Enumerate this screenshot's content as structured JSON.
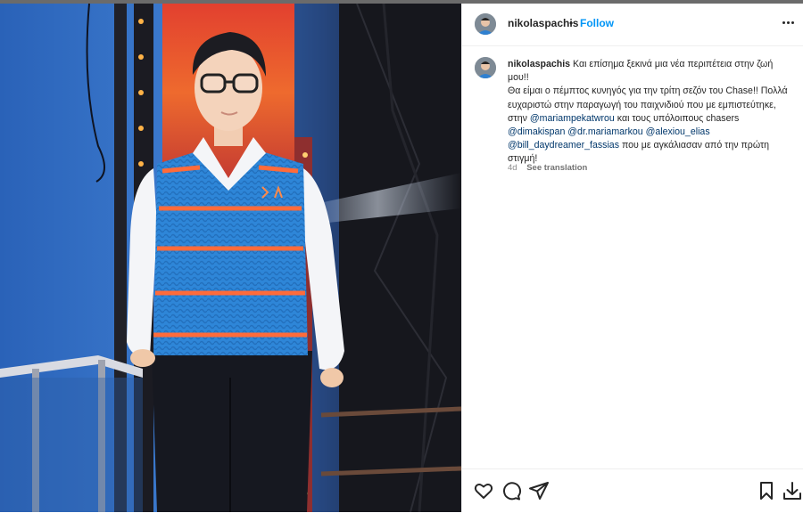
{
  "post": {
    "username": "nikolaspachis",
    "follow_label": "Follow",
    "dot": "•",
    "caption": {
      "t1": "Και επίσημα ξεκινά μια νέα περιπέτεια στην ζωή μου!!",
      "t2": "Θα είμαι ο πέμπτος κυνηγός για την τρίτη σεζόν του Chase!! Πολλά ευχαριστώ στην παραγωγή του παιχνιδιού που με εμπιστεύτηκε, στην",
      "m1": "@mariampekatwrou",
      "t3": "και τους υπόλοιπους chasers",
      "m2": "@dimakispan",
      "m3": "@dr.mariamarkou",
      "m4": "@alexiou_elias",
      "m5": "@bill_daydreamer_fassias",
      "t4": "που με αγκάλιασαν από την πρώτη στιγμή!"
    },
    "time_ago": "4d",
    "see_translation": "See translation"
  },
  "icons": {
    "more": "more-options-icon",
    "like": "heart-icon",
    "comment": "comment-icon",
    "share": "share-icon",
    "save": "bookmark-icon",
    "download": "download-icon"
  },
  "colors": {
    "follow": "#0095f6",
    "mention": "#00376b",
    "secondary_text": "#8e8e8e"
  }
}
